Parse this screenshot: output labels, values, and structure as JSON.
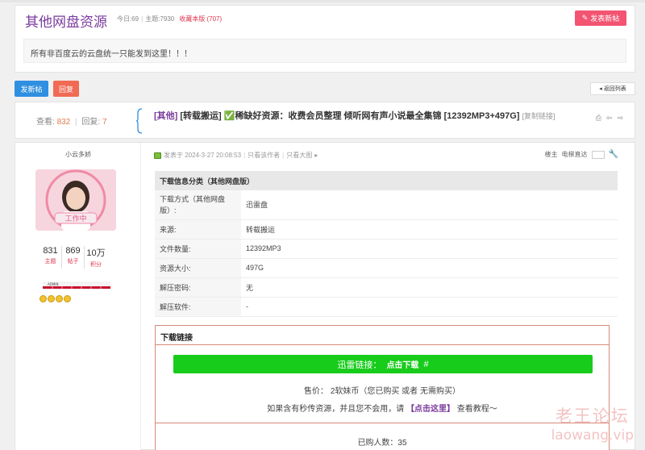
{
  "forum": {
    "title": "其他网盘资源",
    "today": "今日:69",
    "topics": "主题:7930",
    "favorite": "收藏本版 (707)",
    "new_post_label": "发表新帖",
    "description": "所有非百度云的云盘统一只能发到这里！！！"
  },
  "actions": {
    "new_post": "发新帖",
    "reply": "回复",
    "back": "返回列表"
  },
  "thread": {
    "views_label": "查看:",
    "views": "832",
    "replies_label": "回复:",
    "replies": "7",
    "tag": "[其他]",
    "title": "[转载搬运] ✅稀缺好资源：收费会员整理 倾听网有声小说最全集锦 [12392MP3+497G]",
    "copy_link": "[复制链接]"
  },
  "author": {
    "name": "小云多娇",
    "avatar_text": "工作中",
    "stats": [
      {
        "value": "831",
        "label": "主题"
      },
      {
        "value": "869",
        "label": "帖子"
      },
      {
        "value": "10万",
        "label": "积分"
      }
    ],
    "level_text": "ADMIN"
  },
  "post": {
    "meta_posted": "发表于 2024-3-27 20:08:53",
    "author_only": "只看该作者",
    "big_image": "只看大图",
    "floor": "楼主",
    "jump": "电梯直达"
  },
  "info": {
    "header": "下载信息分类（其他网盘版）",
    "rows": [
      {
        "k": "下载方式（其他网盘版）:",
        "v": "迅雷盘"
      },
      {
        "k": "来源:",
        "v": "转载搬运"
      },
      {
        "k": "文件数量:",
        "v": "12392MP3"
      },
      {
        "k": "资源大小:",
        "v": "497G"
      },
      {
        "k": "解压密码:",
        "v": "无"
      },
      {
        "k": "解压软件:",
        "v": "-"
      }
    ]
  },
  "download": {
    "header": "下载链接",
    "btn_prefix": "迅雷链接：",
    "btn_action": "点击下载",
    "btn_hash": "#",
    "price": "售价： 2软妹币（您已购买 或者 无需购买）",
    "hint_before": "如果含有秒传资源，并且您不会用，请",
    "hint_link": "【点击这里】",
    "hint_after": "查看教程～",
    "buyers": "已购人数：35"
  },
  "watermark": {
    "cn": "老王论坛",
    "en": "laowang.vip"
  },
  "colors": {
    "accent": "#7a3a9c",
    "download": "#18cc1c",
    "pink": "#f25472"
  }
}
